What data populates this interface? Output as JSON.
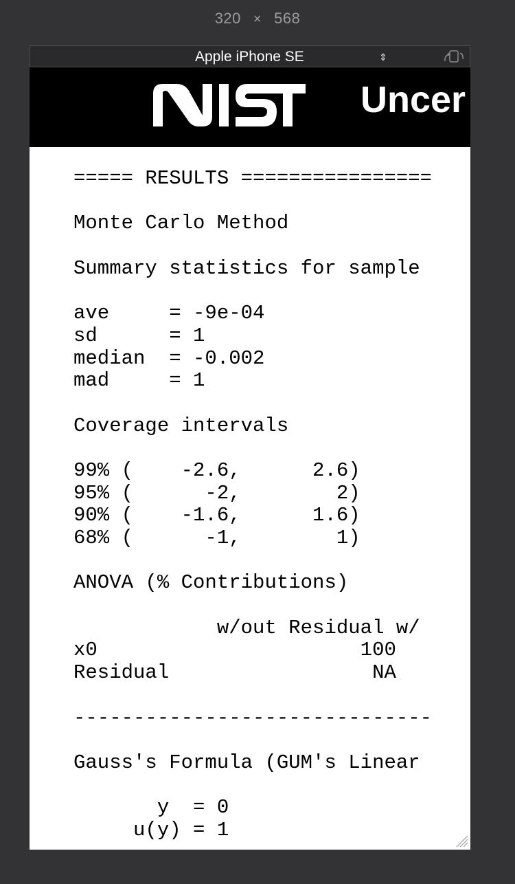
{
  "viewport_size": {
    "width": "320",
    "separator": "×",
    "height": "568"
  },
  "toolbar": {
    "device_name": "Apple iPhone SE",
    "device_caret": "⇕",
    "rotate_icon": "rotate-device-icon"
  },
  "banner": {
    "logo_text": "NIST",
    "title": "Uncer"
  },
  "results_lines": [
    "===== RESULTS ================",
    "",
    "Monte Carlo Method",
    "",
    "Summary statistics for sample",
    "",
    "ave     = -9e-04",
    "sd      = 1",
    "median  = -0.002",
    "mad     = 1",
    "",
    "Coverage intervals",
    "",
    "99% (    -2.6,      2.6)",
    "95% (      -2,        2)",
    "90% (    -1.6,      1.6)",
    "68% (      -1,        1)",
    "",
    "ANOVA (% Contributions)",
    "",
    "            w/out Residual w/",
    "x0                      100",
    "Residual                 NA",
    "",
    "------------------------------",
    "",
    "Gauss's Formula (GUM's Linear",
    "",
    "       y  = 0",
    "     u(y) = 1"
  ],
  "colors": {
    "app_background": "#333336",
    "banner_background": "#000000",
    "page_background": "#ffffff"
  }
}
